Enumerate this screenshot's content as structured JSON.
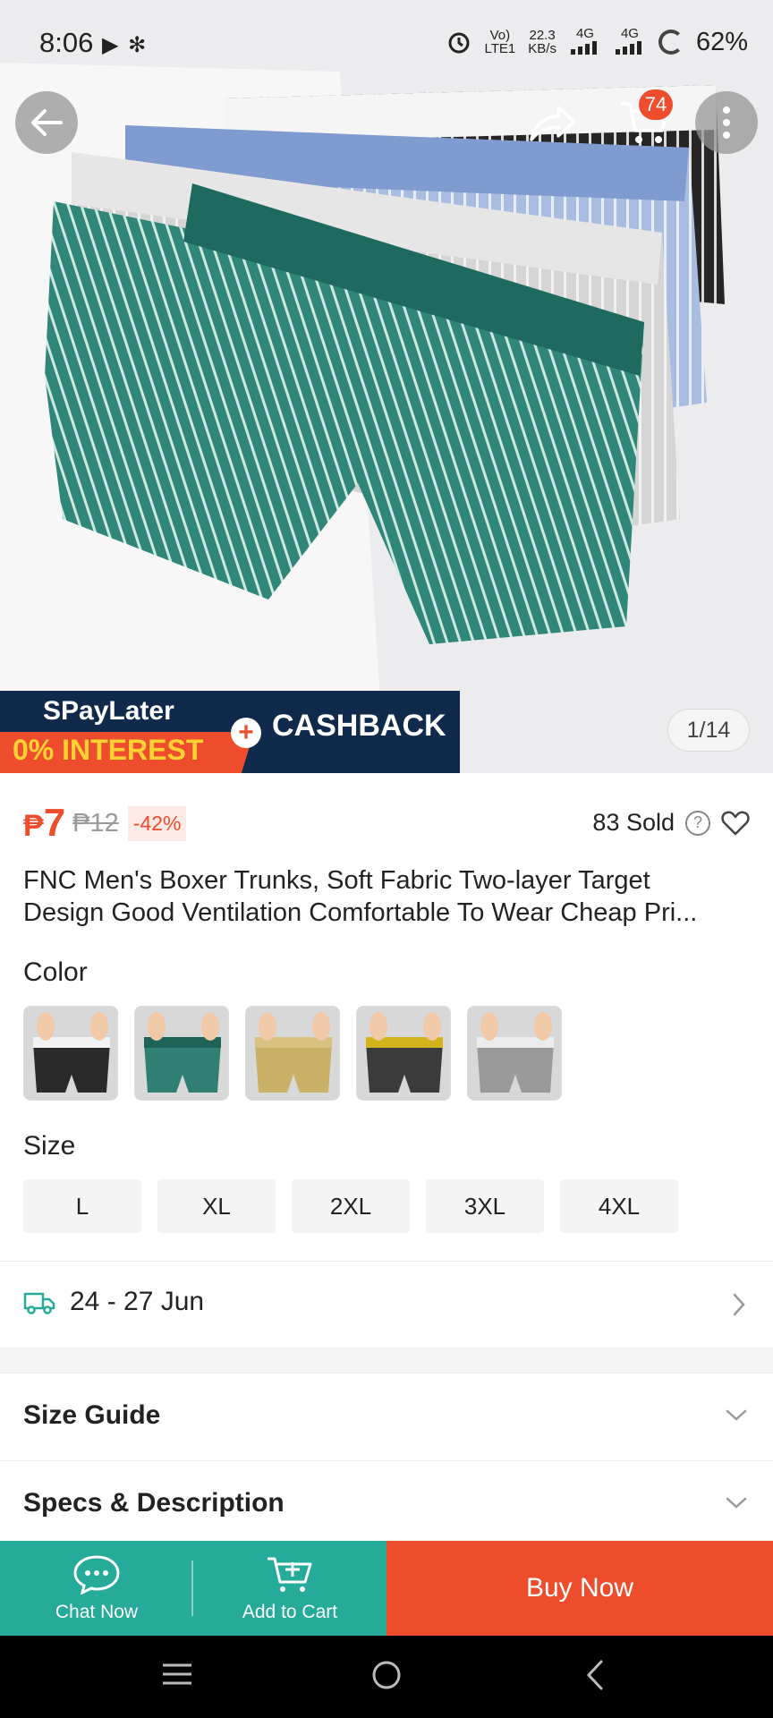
{
  "status_bar": {
    "time": "8:06",
    "left_icons": "▶ ✻",
    "network_1": "Vo)",
    "network_1_sub": "LTE1",
    "speed_value": "22.3",
    "speed_unit": "KB/s",
    "net_4g_a": "4G",
    "net_4g_b": "4G",
    "battery": "62%"
  },
  "header": {
    "cart_count": "74"
  },
  "hero": {
    "image_counter": "1/14",
    "promo_line1": "SPayLater",
    "promo_line2": "0% INTEREST",
    "promo_cashback": "CASHBACK",
    "promo_plus": "+"
  },
  "price": {
    "currency": "₱",
    "current": "7",
    "original": "₱12",
    "discount": "-42%"
  },
  "sold": {
    "text": "83 Sold",
    "help": "?"
  },
  "product": {
    "title_line1": "FNC Men's Boxer Trunks, Soft Fabric Two-layer Target",
    "title_line2": "Design Good Ventilation Comfortable To Wear Cheap Pri..."
  },
  "color": {
    "label": "Color",
    "options": [
      {
        "name": "black",
        "fabric": "#2a2a2a",
        "band": "#f2f2f2"
      },
      {
        "name": "green",
        "fabric": "#2f7f72",
        "band": "#1f6258"
      },
      {
        "name": "khaki",
        "fabric": "#c9b167",
        "band": "#d7c37f"
      },
      {
        "name": "dark-grey",
        "fabric": "#3b3b3b",
        "band": "#d4b41c"
      },
      {
        "name": "grey",
        "fabric": "#9a9a9a",
        "band": "#ececec"
      }
    ]
  },
  "size": {
    "label": "Size",
    "options": [
      "L",
      "XL",
      "2XL",
      "3XL",
      "4XL"
    ]
  },
  "delivery": {
    "dates": "24 - 27 Jun"
  },
  "sections": {
    "size_guide": "Size Guide",
    "specs": "Specs & Description"
  },
  "actions": {
    "chat": "Chat Now",
    "add_to_cart": "Add to Cart",
    "buy_now": "Buy Now"
  },
  "colors": {
    "brand_orange": "#ee4d2d",
    "action_teal": "#26aa99"
  }
}
